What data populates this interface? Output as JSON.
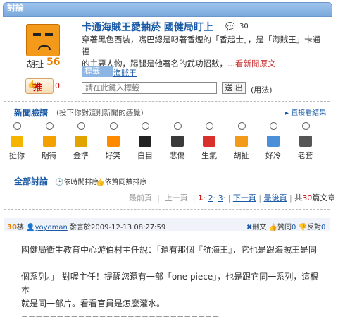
{
  "header": {
    "title": "討論"
  },
  "user": {
    "name": "胡扯",
    "score": "56"
  },
  "push": {
    "label": "推",
    "count": "0"
  },
  "article": {
    "title": "卡通海賊王愛抽菸 國健局盯上",
    "comment_count": "30",
    "desc_lines": [
      "穿著黑色西裝，嘴巴總是叼著香煙的「香起士」，是「海賊王」卡通裡",
      "的主要人物，踢腿是他著名的武功招數，"
    ],
    "more_link": "...看新聞原文"
  },
  "tags": {
    "label": "標籤",
    "tag": "海賊王",
    "input_placeholder": "請在此鍵入標籤",
    "submit": "送 出",
    "usage": "(用法)"
  },
  "mood": {
    "title": "新聞臉譜",
    "subtitle": "(投下你對這則新聞的感覺)",
    "results_link": "直接看結果",
    "items": [
      "挺你",
      "期待",
      "金準",
      "好笑",
      "白目",
      "悲傷",
      "生氣",
      "胡扯",
      "好冷",
      "老套"
    ],
    "colors": [
      "#f4b400",
      "#f4a000",
      "#e0a300",
      "#ff8a00",
      "#222222",
      "#3a3a3a",
      "#d9302b",
      "#f39a1a",
      "#4a8fd8",
      "#555555"
    ]
  },
  "discussion": {
    "title": "全部討論",
    "sort_time": "依時間排序",
    "sort_like": "依贊同數排序",
    "pager": {
      "first": "最前頁",
      "prev": "上一頁",
      "pages": [
        "1",
        "2",
        "3"
      ],
      "next": "下一頁",
      "last": "最後頁",
      "total_prefix": "共",
      "total": "30",
      "total_suffix": "篇文章"
    }
  },
  "post": {
    "floor": "30",
    "floor_suffix": "樓",
    "author": "yoyoman",
    "posted_label": "發言於",
    "time": "2009-12-13 08:27:59",
    "delete": "刪文",
    "agree_label": "贊同",
    "agree": "0",
    "disagree_label": "反對",
    "disagree": "0",
    "lines": [
      "國健局衛生教育中心游伯村主任說：「還有那個『航海王』，它也是跟海賊王是同一",
      "個系列。」 對喔主任！提醒您還有一部「one piece」，也是跟它同一系列，這根本",
      "就是同一部片。看看官員是怎麼灌水。",
      "============================"
    ]
  }
}
